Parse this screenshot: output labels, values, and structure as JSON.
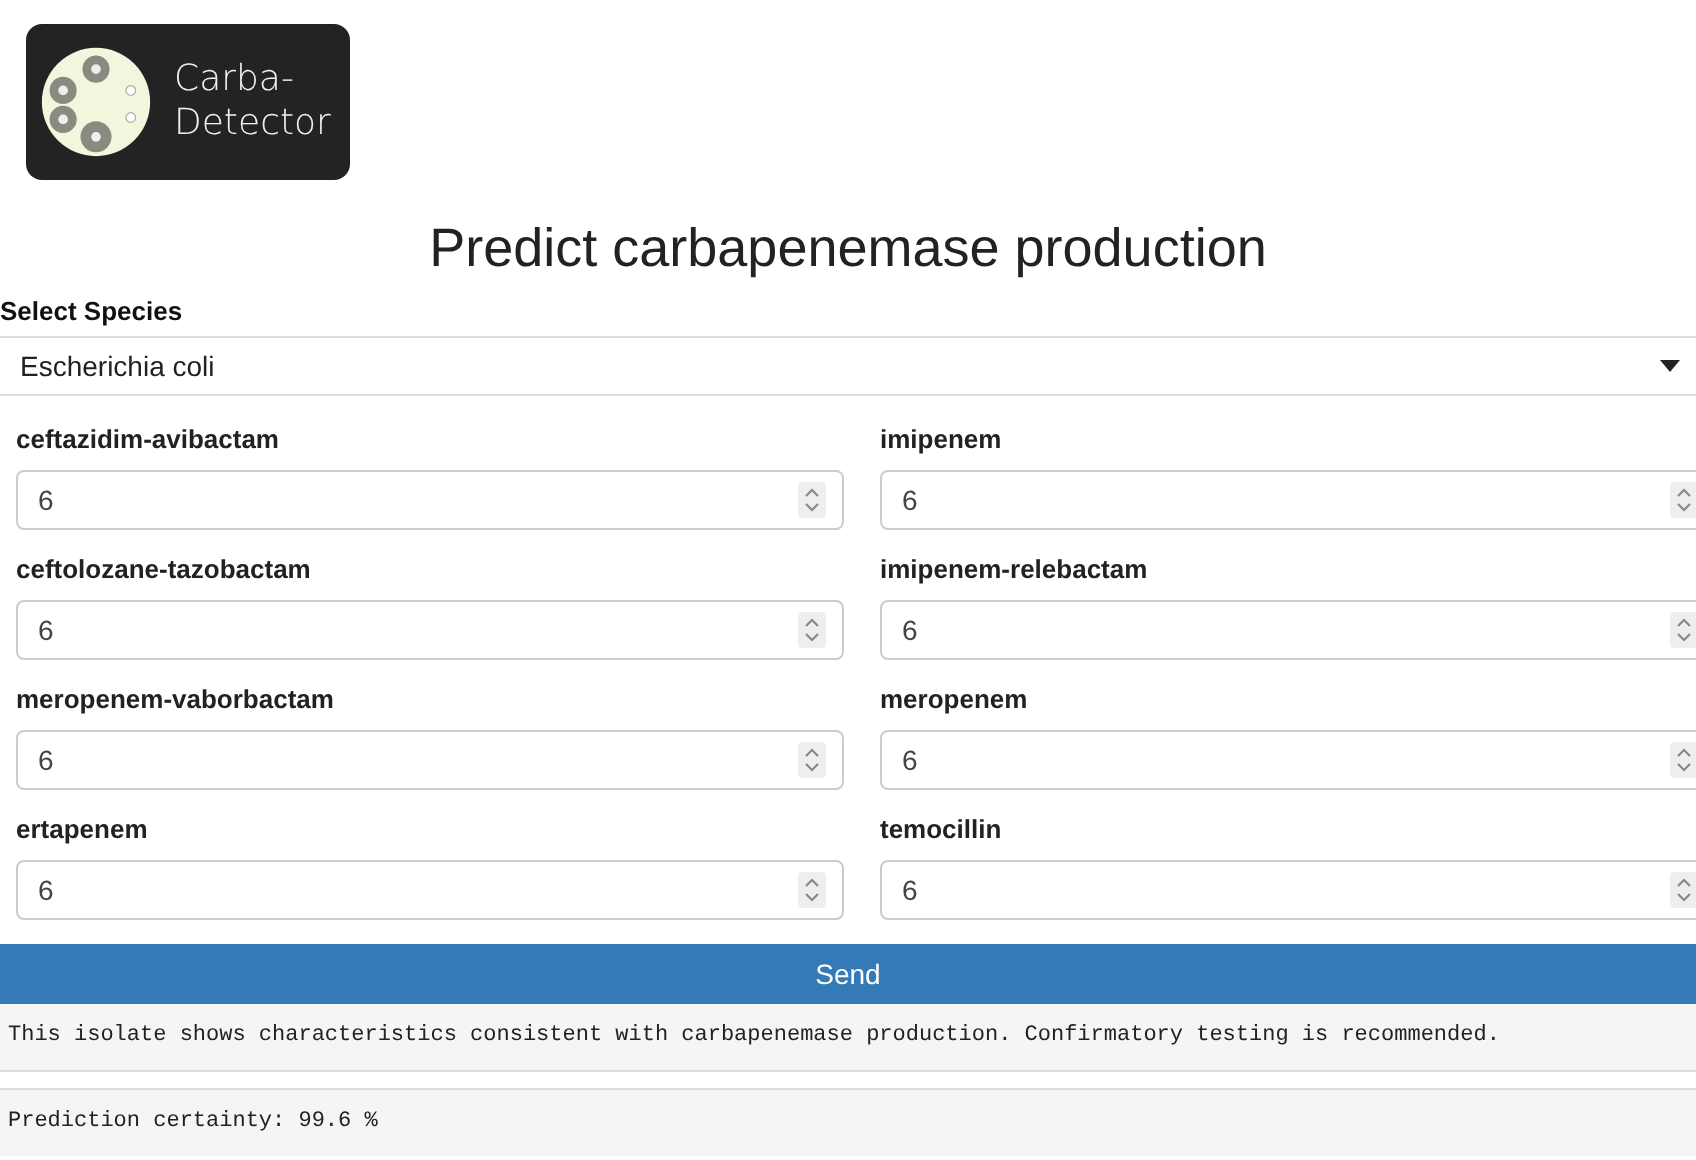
{
  "logo": {
    "line1": "Carba-",
    "line2": "Detector"
  },
  "title": "Predict carbapenemase production",
  "species": {
    "label": "Select Species",
    "value": "Escherichia coli"
  },
  "fields": [
    {
      "label": "ceftazidim-avibactam",
      "value": "6"
    },
    {
      "label": "imipenem",
      "value": "6"
    },
    {
      "label": "ceftolozane-tazobactam",
      "value": "6"
    },
    {
      "label": "imipenem-relebactam",
      "value": "6"
    },
    {
      "label": "meropenem-vaborbactam",
      "value": "6"
    },
    {
      "label": "meropenem",
      "value": "6"
    },
    {
      "label": "ertapenem",
      "value": "6"
    },
    {
      "label": "temocillin",
      "value": "6"
    }
  ],
  "send_button": "Send",
  "outputs": [
    "This isolate shows characteristics consistent with carbapenemase production. Confirmatory testing is recommended.",
    "Prediction certainty: 99.6 %"
  ]
}
